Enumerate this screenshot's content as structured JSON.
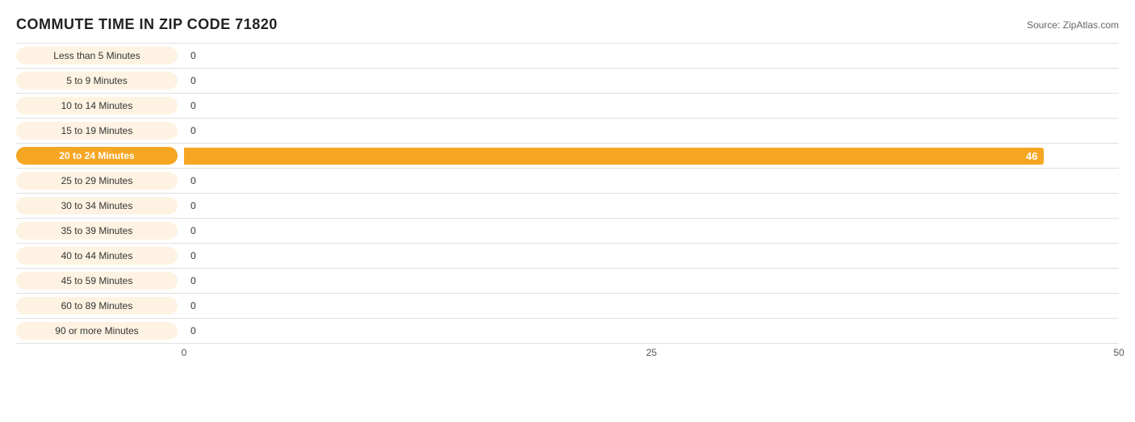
{
  "chart": {
    "title": "COMMUTE TIME IN ZIP CODE 71820",
    "source": "Source: ZipAtlas.com",
    "bars": [
      {
        "label": "Less than 5 Minutes",
        "value": 0,
        "highlight": false
      },
      {
        "label": "5 to 9 Minutes",
        "value": 0,
        "highlight": false
      },
      {
        "label": "10 to 14 Minutes",
        "value": 0,
        "highlight": false
      },
      {
        "label": "15 to 19 Minutes",
        "value": 0,
        "highlight": false
      },
      {
        "label": "20 to 24 Minutes",
        "value": 46,
        "highlight": true
      },
      {
        "label": "25 to 29 Minutes",
        "value": 0,
        "highlight": false
      },
      {
        "label": "30 to 34 Minutes",
        "value": 0,
        "highlight": false
      },
      {
        "label": "35 to 39 Minutes",
        "value": 0,
        "highlight": false
      },
      {
        "label": "40 to 44 Minutes",
        "value": 0,
        "highlight": false
      },
      {
        "label": "45 to 59 Minutes",
        "value": 0,
        "highlight": false
      },
      {
        "label": "60 to 89 Minutes",
        "value": 0,
        "highlight": false
      },
      {
        "label": "90 or more Minutes",
        "value": 0,
        "highlight": false
      }
    ],
    "xAxis": {
      "ticks": [
        {
          "label": "0",
          "percent": 0
        },
        {
          "label": "25",
          "percent": 50
        },
        {
          "label": "50",
          "percent": 100
        }
      ],
      "max": 50
    }
  }
}
